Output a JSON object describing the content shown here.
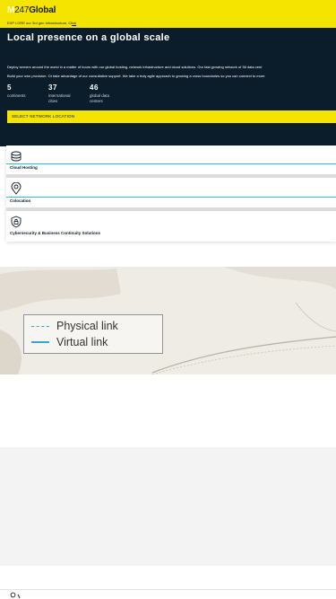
{
  "header": {
    "logo_m": "M",
    "logo_num": "247",
    "logo_g": "Global",
    "notice_text": "EXP LORE our 3rd gen Infrastructure, Cl",
    "notice_link": "ick"
  },
  "hero": {
    "title": "Local presence on a global scale",
    "desc_1": "Deploy servers around the world in a matter of hours with our global hosting, network infrastructure and cloud solutions. Our fast growing network of 36 data cent",
    "desc_2": "Build your own provision. Or take advantage of our consultative support. We take a truly agile approach to growing a cross boundaries so you can connect to more",
    "stats": [
      {
        "value": "5",
        "label": "continents"
      },
      {
        "value": "37",
        "label": "international cities"
      },
      {
        "value": "46",
        "label": "global data centers"
      }
    ],
    "select_label": "SELECT NETWORK LOCATION"
  },
  "services": [
    {
      "label": "Cloud Hosting",
      "icon": "cloud-stack-icon"
    },
    {
      "label": "Colocation",
      "icon": "location-pin-icon"
    },
    {
      "label": "Cybersecurity & Business Continuity Solutions",
      "icon": "shield-lock-icon"
    }
  ],
  "map": {
    "legend_physical": "Physical link",
    "legend_virtual": "Virtual link",
    "link_color": "#3aa6c6"
  },
  "colors": {
    "brand_yellow": "#f5e300",
    "brand_navy": "#0b1d2b",
    "accent_teal": "#28c2d1"
  }
}
